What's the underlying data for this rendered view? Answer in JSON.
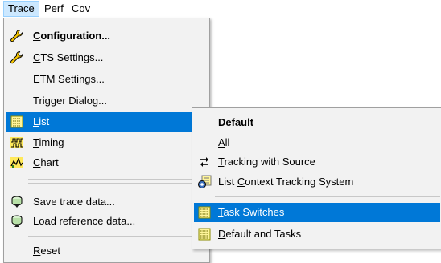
{
  "menubar": {
    "items": [
      {
        "label": "Trace"
      },
      {
        "label": "Perf"
      },
      {
        "label": "Cov"
      }
    ]
  },
  "trace_menu": {
    "items": [
      {
        "label_u": "C",
        "label_rest": "onfiguration...",
        "icon": "wrench-icon"
      },
      {
        "label_u": "C",
        "label_rest": "TS Settings...",
        "icon": "wrench-icon"
      },
      {
        "label_pre": "ETM Settings..."
      },
      {
        "label_pre": "Trigger Dialog..."
      },
      {
        "label_u": "L",
        "label_rest": "ist",
        "icon": "list-icon"
      },
      {
        "label_u": "T",
        "label_rest": "iming",
        "icon": "timing-icon"
      },
      {
        "label_u": "C",
        "label_rest": "hart",
        "icon": "chart-icon"
      },
      {
        "label_pre": "Save trace data...",
        "icon": "save-trace-icon"
      },
      {
        "label_pre": "Load reference data...",
        "icon": "load-reference-icon"
      },
      {
        "label_u": "R",
        "label_rest": "eset"
      }
    ]
  },
  "list_submenu": {
    "items": [
      {
        "label_u": "D",
        "label_rest": "efault"
      },
      {
        "label_u": "A",
        "label_rest": "ll"
      },
      {
        "label_u": "T",
        "label_rest": "racking with Source",
        "icon": "tracking-arrows-icon"
      },
      {
        "label_pre": "List ",
        "label_u": "C",
        "label_rest": "ontext Tracking System",
        "icon": "context-tracking-icon"
      },
      {
        "label_u": "T",
        "label_rest": "ask Switches",
        "icon": "list-icon"
      },
      {
        "label_u": "D",
        "label_rest": "efault and Tasks",
        "icon": "list-icon"
      }
    ]
  },
  "colors": {
    "highlight": "#0078d7",
    "menu_bg": "#f2f2f2",
    "menubar_active": "#cce8ff"
  }
}
